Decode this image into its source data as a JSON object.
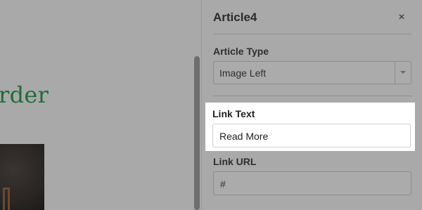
{
  "canvas": {
    "heading_fragment": "rder"
  },
  "panel": {
    "title": "Article4",
    "close_symbol": "×",
    "article_type": {
      "label": "Article Type",
      "selected": "Image Left"
    },
    "link_text": {
      "label": "Link Text",
      "value": "Read More"
    },
    "link_url": {
      "label": "Link URL",
      "value": "#"
    }
  },
  "colors": {
    "overlay_gray": "#a9a9a9",
    "heading_green": "#1f6b3a",
    "spotlight_bg": "#ffffff"
  },
  "icons": {
    "close": "close-icon",
    "dropdown": "chevron-down-icon"
  }
}
